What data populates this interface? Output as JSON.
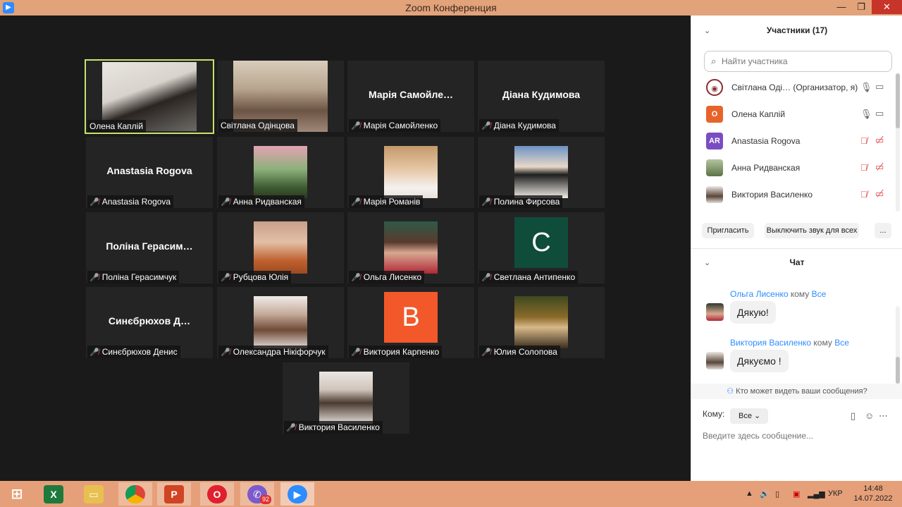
{
  "window": {
    "title": "Zoom Конференция"
  },
  "tiles": [
    {
      "name": "Олена Каплій",
      "big": "",
      "muted": false,
      "active": true,
      "kind": "photo",
      "color": "#8a8f96"
    },
    {
      "name": "Світлана Одінцова",
      "big": "",
      "muted": false,
      "active": false,
      "kind": "photo",
      "color": "#b8a48e"
    },
    {
      "name": "Марія Самойленко",
      "big": "Марія  Самойле…",
      "muted": true,
      "active": false,
      "kind": "text"
    },
    {
      "name": "Діана Кудимова",
      "big": "Діана Кудимова",
      "muted": true,
      "active": false,
      "kind": "text"
    },
    {
      "name": "Anastasia Rogova",
      "big": "Anastasia Rogova",
      "muted": true,
      "active": false,
      "kind": "text"
    },
    {
      "name": "Анна Ридванская",
      "big": "",
      "muted": true,
      "active": false,
      "kind": "photo",
      "color": "#5d7f4a"
    },
    {
      "name": "Марія Романів",
      "big": "",
      "muted": true,
      "active": false,
      "kind": "photo",
      "color": "#c9a98a"
    },
    {
      "name": "Полина Фирсова",
      "big": "",
      "muted": true,
      "active": false,
      "kind": "photo",
      "color": "#7b9cc0"
    },
    {
      "name": "Поліна Герасимчук",
      "big": "Поліна  Герасим…",
      "muted": true,
      "active": false,
      "kind": "text"
    },
    {
      "name": "Рубцова Юлія",
      "big": "",
      "muted": true,
      "active": false,
      "kind": "photo",
      "color": "#c47a55"
    },
    {
      "name": "Ольга Лисенко",
      "big": "",
      "muted": true,
      "active": false,
      "kind": "photo",
      "color": "#4a3a3a"
    },
    {
      "name": "Светлана Антипенко",
      "big": "",
      "muted": true,
      "active": false,
      "kind": "letter",
      "letter": "C",
      "color": "#0f4d3a"
    },
    {
      "name": "Синєбрюхов Денис",
      "big": "Синєбрюхов  Д…",
      "muted": true,
      "active": false,
      "kind": "text"
    },
    {
      "name": "Олександра Нікіфорчук",
      "big": "",
      "muted": true,
      "active": false,
      "kind": "photo",
      "color": "#d8c8bc"
    },
    {
      "name": "Виктория Карпенко",
      "big": "",
      "muted": true,
      "active": false,
      "kind": "letter",
      "letter": "B",
      "color": "#f2582a"
    },
    {
      "name": "Юлия Солопова",
      "big": "",
      "muted": true,
      "active": false,
      "kind": "photo",
      "color": "#5a4a26"
    },
    {
      "name": "Виктория Василенко",
      "big": "",
      "muted": true,
      "active": false,
      "kind": "photo",
      "color": "#e2ddd8"
    }
  ],
  "participants": {
    "title": "Участники (17)",
    "search_placeholder": "Найти участника",
    "list": [
      {
        "name": "Світлана Оді…  (Организатор, я)",
        "initials": "",
        "color": "#8b2d2d",
        "muted": false
      },
      {
        "name": "Олена Каплій",
        "initials": "О",
        "color": "#e8632b",
        "muted": false
      },
      {
        "name": "Anastasia Rogova",
        "initials": "AR",
        "color": "#7a4cc4",
        "muted": true
      },
      {
        "name": "Анна Ридванская",
        "initials": "",
        "color": "#6f8a5a",
        "muted": true
      },
      {
        "name": "Виктория Василенко",
        "initials": "",
        "color": "#d8cfc8",
        "muted": true
      }
    ],
    "invite_label": "Пригласить",
    "mute_all_label": "Выключить звук для всех",
    "more_label": "..."
  },
  "chat": {
    "title": "Чат",
    "to_word": "кому",
    "messages": [
      {
        "sender": "Ольга Лисенко",
        "to": "Все",
        "text": "Дякую!",
        "color": "#5a3a3a"
      },
      {
        "sender": "Виктория Василенко",
        "to": "Все",
        "text": "Дякуємо !",
        "color": "#d8cfc8"
      }
    ],
    "who_can_see": "Кто может видеть ваши сообщения?",
    "to_label": "Кому:",
    "to_value": "Все",
    "input_placeholder": "Введите здесь сообщение..."
  },
  "taskbar": {
    "viber_badge": "92",
    "lang": "УКР",
    "time": "14:48",
    "date": "14.07.2022"
  }
}
